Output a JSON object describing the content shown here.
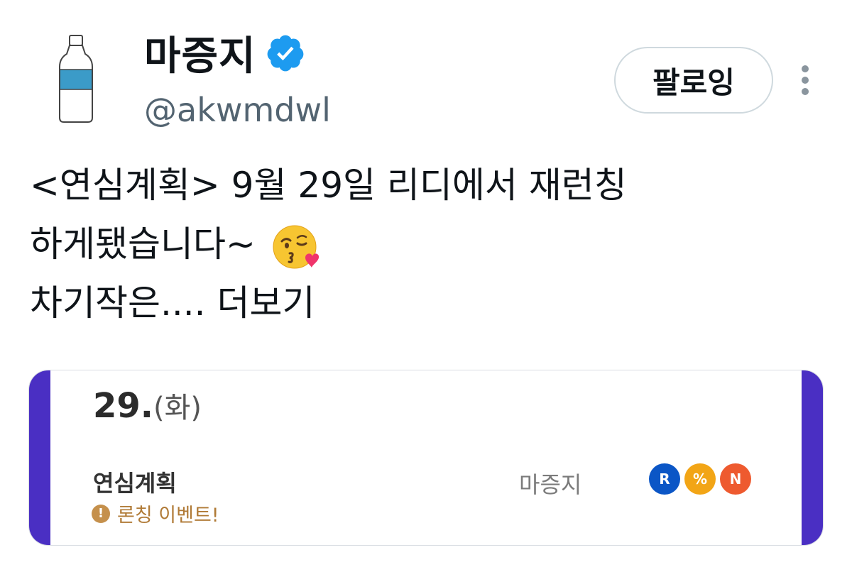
{
  "profile": {
    "name": "마증지",
    "handle": "@akwmdwl",
    "verified": true,
    "avatar_icon": "water-bottle-icon"
  },
  "actions": {
    "follow_label": "팔로잉",
    "more_icon": "vertical-dots-icon"
  },
  "tweet": {
    "line1": "<연심계획> 9월 29일 리디에서 재런칭",
    "line2": "하게됐습니다~",
    "emoji": "face-blowing-a-kiss-icon",
    "line3": "차기작은....",
    "more_label": "더보기"
  },
  "card": {
    "date_day": "29.",
    "date_dow": "(화)",
    "title": "연심계획",
    "event_label": "론칭 이벤트!",
    "event_icon": "exclamation-circle-icon",
    "author": "마증지",
    "platforms": [
      {
        "label": "R",
        "color": "#0b56c6"
      },
      {
        "label": "%",
        "color": "#f2a516"
      },
      {
        "label": "N",
        "color": "#ee5a2f"
      }
    ],
    "accent_color": "#4a2fc3"
  },
  "colors": {
    "verified": "#1d9bf0",
    "handle": "#536471"
  }
}
